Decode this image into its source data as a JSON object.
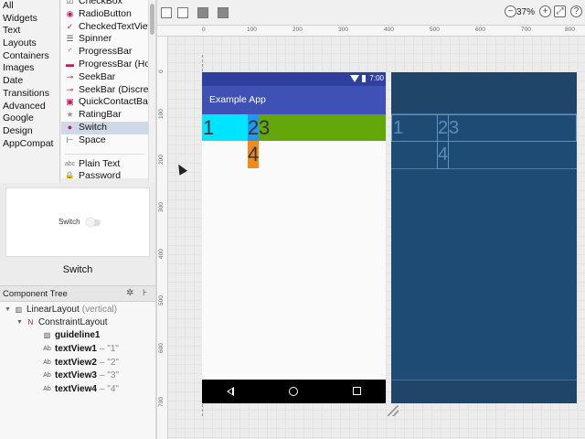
{
  "palette": {
    "categories": [
      "All",
      "Widgets",
      "Text",
      "Layouts",
      "Containers",
      "Images",
      "Date",
      "Transitions",
      "Advanced",
      "Google",
      "Design",
      "AppCompat"
    ],
    "items": [
      {
        "label": "CheckBox",
        "icon": "checkbox-icon"
      },
      {
        "label": "RadioButton",
        "icon": "radio-button-icon"
      },
      {
        "label": "CheckedTextView",
        "icon": "checked-text-view-icon"
      },
      {
        "label": "Spinner",
        "icon": "spinner-icon"
      },
      {
        "label": "ProgressBar",
        "icon": "progress-bar-icon"
      },
      {
        "label": "ProgressBar (Horizontal)",
        "icon": "progress-bar-horizontal-icon"
      },
      {
        "label": "SeekBar",
        "icon": "seek-bar-icon"
      },
      {
        "label": "SeekBar (Discrete)",
        "icon": "seek-bar-discrete-icon"
      },
      {
        "label": "QuickContactBadge",
        "icon": "contact-badge-icon"
      },
      {
        "label": "RatingBar",
        "icon": "star-icon"
      },
      {
        "label": "Switch",
        "icon": "switch-icon"
      },
      {
        "label": "Space",
        "icon": "space-icon"
      }
    ],
    "items_text": [
      {
        "label": "Plain Text",
        "icon": "plain-text-icon"
      },
      {
        "label": "Password",
        "icon": "password-icon"
      }
    ],
    "selected": "Switch"
  },
  "preview": {
    "widget_label": "Switch",
    "title": "Switch"
  },
  "component_tree": {
    "header": "Component Tree",
    "nodes": [
      {
        "label": "LinearLayout",
        "sub": "(vertical)"
      },
      {
        "label": "ConstraintLayout",
        "sub": ""
      },
      {
        "label": "guideline1",
        "sub": ""
      },
      {
        "label": "textView1",
        "sub": "– \"1\""
      },
      {
        "label": "textView2",
        "sub": "– \"2\""
      },
      {
        "label": "textView3",
        "sub": "– \"3\""
      },
      {
        "label": "textView4",
        "sub": "– \"4\""
      }
    ]
  },
  "toolbar": {
    "zoom": "37%"
  },
  "rulers": {
    "top": [
      "0",
      "100",
      "200",
      "300",
      "400",
      "500",
      "600",
      "700",
      "800"
    ],
    "left": [
      "0",
      "100",
      "200",
      "300",
      "400",
      "500",
      "600",
      "700"
    ]
  },
  "design": {
    "status_time": "7:00",
    "app_title": "Example App",
    "tv1": "1",
    "tv2": "2",
    "tv3": "3",
    "tv4": "4",
    "colors": {
      "primary_dark": "#303f9f",
      "primary": "#3f51b5",
      "tv1": "#00e5ff",
      "tv2": "#2196f3",
      "tv3": "#64a70b",
      "tv4": "#ef8b1a",
      "blueprint": "#1e4b73"
    }
  },
  "blueprint": {
    "tv1": "1",
    "tv2": "2",
    "tv3": "3",
    "tv4": "4"
  }
}
